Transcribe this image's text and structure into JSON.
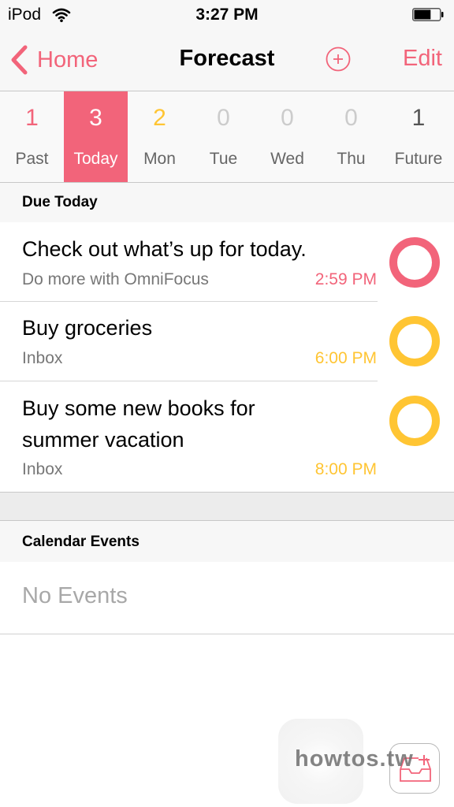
{
  "status_bar": {
    "carrier": "iPod",
    "time": "3:27 PM",
    "battery_level": 0.65,
    "icons": [
      "wifi-icon",
      "battery-icon"
    ]
  },
  "nav": {
    "back_label": "Home",
    "title": "Forecast",
    "add_icon": "plus-circle-icon",
    "edit_label": "Edit"
  },
  "colors": {
    "accent": "#f2647a",
    "due_soon": "#ffc533",
    "zero": "#cccccc",
    "future": "#555555"
  },
  "days": [
    {
      "count": "1",
      "label": "Past",
      "color": "#f2647a",
      "selected": false
    },
    {
      "count": "3",
      "label": "Today",
      "color": "#ffffff",
      "selected": true
    },
    {
      "count": "2",
      "label": "Mon",
      "color": "#ffc533",
      "selected": false
    },
    {
      "count": "0",
      "label": "Tue",
      "color": "#cccccc",
      "selected": false
    },
    {
      "count": "0",
      "label": "Wed",
      "color": "#cccccc",
      "selected": false
    },
    {
      "count": "0",
      "label": "Thu",
      "color": "#cccccc",
      "selected": false
    },
    {
      "count": "1",
      "label": "Future",
      "color": "#555555",
      "selected": false
    }
  ],
  "due_today": {
    "header": "Due Today",
    "tasks": [
      {
        "title": "Check out what’s up for today.",
        "subtitle": "Do more with OmniFocus",
        "time": "2:59 PM",
        "color": "#f2647a"
      },
      {
        "title": "Buy groceries",
        "subtitle": "Inbox",
        "time": "6:00 PM",
        "color": "#ffc533"
      },
      {
        "title": "Buy some new books for summer vacation",
        "subtitle": "Inbox",
        "time": "8:00 PM",
        "color": "#ffc533"
      }
    ]
  },
  "calendar_events": {
    "header": "Calendar Events",
    "empty_text": "No Events"
  },
  "bottom": {
    "inbox_icon": "inbox-add-icon",
    "watermark": "howtos.tw"
  }
}
